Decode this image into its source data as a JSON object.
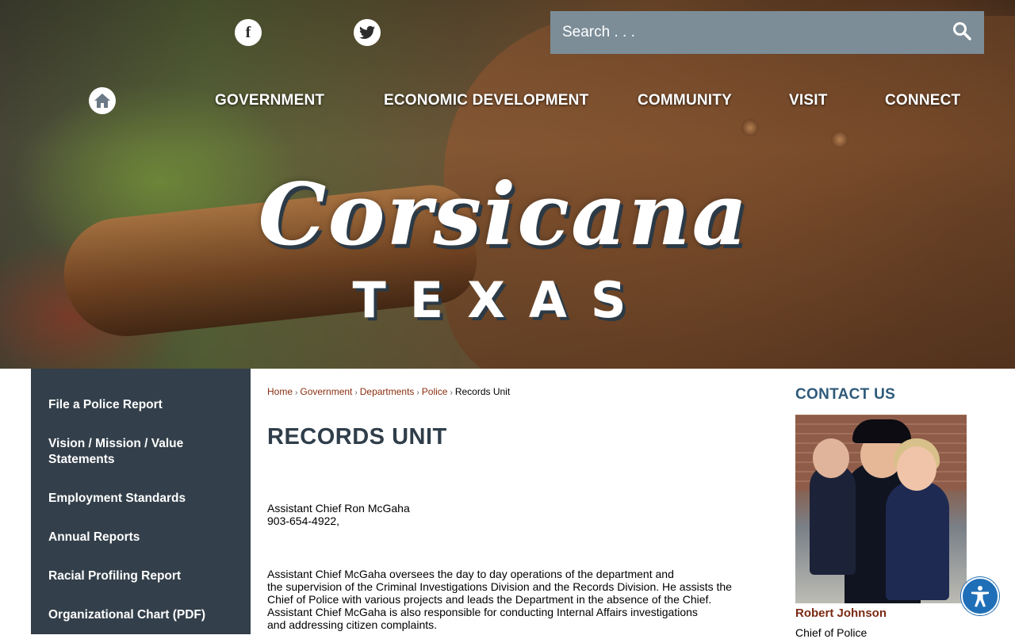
{
  "header": {
    "social": [
      {
        "name": "facebook",
        "glyph": "f"
      },
      {
        "name": "twitter",
        "glyph": ""
      }
    ],
    "search": {
      "placeholder": "Search . . ."
    },
    "nav": {
      "items": [
        {
          "label": "GOVERNMENT"
        },
        {
          "label": "ECONOMIC DEVELOPMENT"
        },
        {
          "label": "COMMUNITY"
        },
        {
          "label": "VISIT"
        },
        {
          "label": "CONNECT"
        }
      ]
    },
    "logo": {
      "script": "Corsicana",
      "sub": "TEXAS"
    }
  },
  "sidebar": {
    "items": [
      {
        "label": "File a Police Report"
      },
      {
        "label": "Vision / Mission / Value Statements"
      },
      {
        "label": "Employment Standards"
      },
      {
        "label": "Annual Reports"
      },
      {
        "label": "Racial Profiling Report"
      },
      {
        "label": "Organizational Chart (PDF)"
      }
    ]
  },
  "breadcrumb": {
    "items": [
      "Home",
      "Government",
      "Departments",
      "Police"
    ],
    "current": "Records Unit",
    "separator": "›"
  },
  "main": {
    "title": "RECORDS UNIT",
    "contact_name": "Assistant Chief Ron McGaha",
    "contact_phone": "903-654-4922,",
    "body_lines": [
      "Assistant Chief McGaha oversees the day to day operations of the department and",
      "the supervision of the Criminal Investigations Division and the Records Division. He assists the",
      "Chief of Police with various projects and leads the Department in the absence of the Chief.",
      "Assistant Chief McGaha is also responsible for conducting Internal Affairs investigations",
      "and addressing citizen complaints."
    ]
  },
  "contact_us": {
    "title": "CONTACT US",
    "name": "Robert Johnson",
    "role": "Chief of Police"
  },
  "colors": {
    "sidebar_bg": "#333f4a",
    "search_bg": "#7c8d98",
    "title": "#2f3e4a",
    "link": "#8a2d0f",
    "contact_title": "#2e5a7a",
    "accessibility": "#1f6fb8"
  },
  "icons": {
    "home": "home-icon",
    "search": "search-icon",
    "facebook": "facebook-icon",
    "twitter": "twitter-icon",
    "accessibility": "accessibility-icon"
  }
}
